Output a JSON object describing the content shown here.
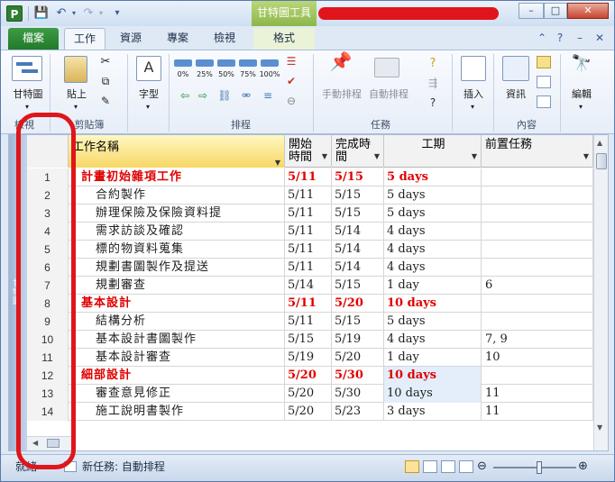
{
  "title_bar": {
    "app_letter": "P",
    "context_tab_header": "甘特圖工具",
    "window_buttons": {
      "minimize": "–",
      "maximize": "□",
      "close": "✕"
    },
    "qat_icons": [
      "save-icon",
      "undo-icon",
      "redo-icon",
      "customize-icon"
    ]
  },
  "tabs": [
    "檔案",
    "工作",
    "資源",
    "專案",
    "檢視",
    "格式"
  ],
  "ribbon": {
    "groups": {
      "view": "檢視",
      "clipboard": "剪貼簿",
      "schedule": "排程",
      "tasks": "任務",
      "content": "內容"
    },
    "buttons": {
      "gantt": "甘特圖",
      "paste": "貼上",
      "font": "字型",
      "manual_schedule": "手動排程",
      "auto_schedule": "自動排程",
      "insert": "插入",
      "info": "資訊",
      "edit": "編輯"
    },
    "percent_buttons": [
      "0%",
      "25%",
      "50%",
      "75%",
      "100%"
    ]
  },
  "table": {
    "headers": {
      "name": "工作名稱",
      "start": "開始時間",
      "finish": "完成時間",
      "duration": "工期",
      "predecessors": "前置任務"
    },
    "rows": [
      {
        "id": "1",
        "name": "計畫初始雜項工作",
        "start": "5/11",
        "finish": "5/15",
        "duration": "5 days",
        "pred": "",
        "summary": true
      },
      {
        "id": "2",
        "name": "合約製作",
        "start": "5/11",
        "finish": "5/15",
        "duration": "5 days",
        "pred": "",
        "summary": false
      },
      {
        "id": "3",
        "name": "辦理保險及保險資料提",
        "start": "5/11",
        "finish": "5/15",
        "duration": "5 days",
        "pred": "",
        "summary": false
      },
      {
        "id": "4",
        "name": "需求訪談及確認",
        "start": "5/11",
        "finish": "5/14",
        "duration": "4 days",
        "pred": "",
        "summary": false
      },
      {
        "id": "5",
        "name": "標的物資料蒐集",
        "start": "5/11",
        "finish": "5/14",
        "duration": "4 days",
        "pred": "",
        "summary": false
      },
      {
        "id": "6",
        "name": "規劃書圖製作及提送",
        "start": "5/11",
        "finish": "5/14",
        "duration": "4 days",
        "pred": "",
        "summary": false
      },
      {
        "id": "7",
        "name": "規劃審查",
        "start": "5/14",
        "finish": "5/15",
        "duration": "1 day",
        "pred": "6",
        "summary": false
      },
      {
        "id": "8",
        "name": "基本設計",
        "start": "5/11",
        "finish": "5/20",
        "duration": "10 days",
        "pred": "",
        "summary": true
      },
      {
        "id": "9",
        "name": "結構分析",
        "start": "5/11",
        "finish": "5/15",
        "duration": "5 days",
        "pred": "",
        "summary": false
      },
      {
        "id": "10",
        "name": "基本設計書圖製作",
        "start": "5/15",
        "finish": "5/19",
        "duration": "4 days",
        "pred": "7, 9",
        "summary": false
      },
      {
        "id": "11",
        "name": "基本設計審查",
        "start": "5/19",
        "finish": "5/20",
        "duration": "1 day",
        "pred": "10",
        "summary": false
      },
      {
        "id": "12",
        "name": "細部設計",
        "start": "5/20",
        "finish": "5/30",
        "duration": "10 days",
        "pred": "",
        "summary": true
      },
      {
        "id": "13",
        "name": "審查意見修正",
        "start": "5/20",
        "finish": "5/30",
        "duration": "10 days",
        "pred": "11",
        "summary": false
      },
      {
        "id": "14",
        "name": "施工說明書製作",
        "start": "5/20",
        "finish": "5/23",
        "duration": "3 days",
        "pred": "11",
        "summary": false
      }
    ]
  },
  "view_bar_label": "甘特圖",
  "status_bar": {
    "ready": "就緒",
    "new_tasks": "新任務: 自動排程"
  },
  "colors": {
    "summary_text": "#e00000",
    "file_tab": "#2e8b36",
    "context_tab": "#9cc45a",
    "annotation": "#e0151b",
    "header_highlight": "#f7d866"
  }
}
